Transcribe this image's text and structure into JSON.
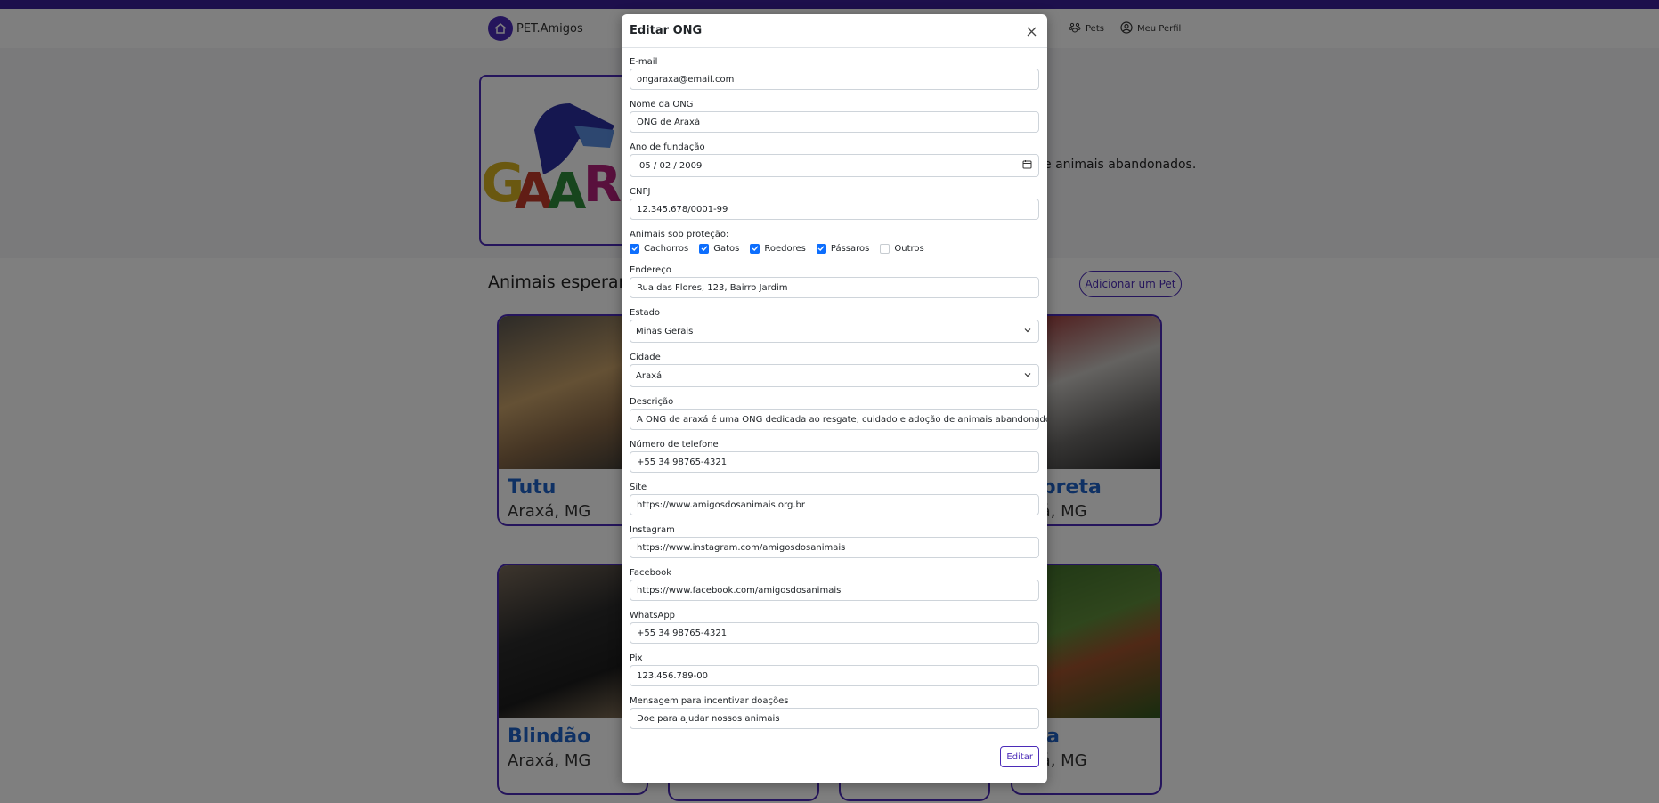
{
  "brand": {
    "name": "PET.Amigos"
  },
  "nav": {
    "pets": "Pets",
    "profile": "Meu Perfil"
  },
  "hero": {
    "logo_text": "GAAR",
    "description_tail": "e animais abandonados."
  },
  "section": {
    "title": "Animais esperan",
    "add_button": "Adicionar um Pet"
  },
  "pets": [
    {
      "name": "Tutu",
      "location": "Araxá, MG"
    },
    {
      "name": "mbreta",
      "location": "axá, MG"
    },
    {
      "name": "Blindão",
      "location": "Araxá, MG"
    },
    {
      "name": "ícia",
      "location": "axá, MG"
    }
  ],
  "modal": {
    "title": "Editar ONG",
    "email": {
      "label": "E-mail",
      "value": "ongaraxa@email.com"
    },
    "nome": {
      "label": "Nome da ONG",
      "value": "ONG de Araxá"
    },
    "ano": {
      "label": "Ano de fundação",
      "value": "05 / 02 / 2009"
    },
    "cnpj": {
      "label": "CNPJ",
      "value": "12.345.678/0001-99"
    },
    "animais": {
      "label": "Animais sob proteção:",
      "options": [
        {
          "label": "Cachorros",
          "checked": true
        },
        {
          "label": "Gatos",
          "checked": true
        },
        {
          "label": "Roedores",
          "checked": true
        },
        {
          "label": "Pássaros",
          "checked": true
        },
        {
          "label": "Outros",
          "checked": false
        }
      ]
    },
    "endereco": {
      "label": "Endereço",
      "value": "Rua das Flores, 123, Bairro Jardim"
    },
    "estado": {
      "label": "Estado",
      "value": "Minas Gerais"
    },
    "cidade": {
      "label": "Cidade",
      "value": "Araxá"
    },
    "descricao": {
      "label": "Descrição",
      "value": "A ONG de araxá é uma ONG dedicada ao resgate, cuidado e adoção de animais abandonados."
    },
    "telefone": {
      "label": "Número de telefone",
      "value": "+55 34 98765-4321"
    },
    "site": {
      "label": "Site",
      "value": "https://www.amigosdosanimais.org.br"
    },
    "instagram": {
      "label": "Instagram",
      "value": "https://www.instagram.com/amigosdosanimais"
    },
    "facebook": {
      "label": "Facebook",
      "value": "https://www.facebook.com/amigosdosanimais"
    },
    "whatsapp": {
      "label": "WhatsApp",
      "value": "+55 34 98765-4321"
    },
    "pix": {
      "label": "Pix",
      "value": "123.456.789-00"
    },
    "mensagem": {
      "label": "Mensagem para incentivar doações",
      "value": "Doe para ajudar nossos animais"
    },
    "submit_label": "Editar"
  },
  "colors": {
    "accent": "#4b2bb8",
    "topbar": "#3a1f99",
    "link_blue": "#1f63c9",
    "check_blue": "#0d6efd"
  }
}
